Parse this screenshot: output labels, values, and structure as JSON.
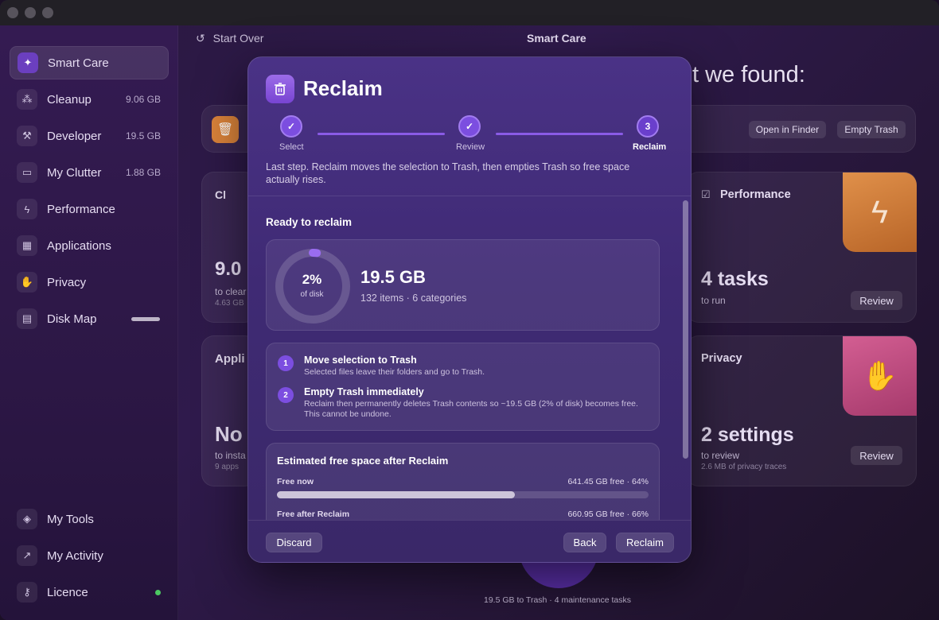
{
  "header": {
    "start_over": "Start Over",
    "title": "Smart Care",
    "found_title": "t we found:"
  },
  "sidebar": {
    "items": [
      {
        "label": "Smart Care",
        "size": ""
      },
      {
        "label": "Cleanup",
        "size": "9.06 GB"
      },
      {
        "label": "Developer",
        "size": "19.5 GB"
      },
      {
        "label": "My Clutter",
        "size": "1.88 GB"
      },
      {
        "label": "Performance",
        "size": ""
      },
      {
        "label": "Applications",
        "size": ""
      },
      {
        "label": "Privacy",
        "size": ""
      },
      {
        "label": "Disk Map",
        "size": ""
      }
    ],
    "bottom_items": [
      {
        "label": "My Tools"
      },
      {
        "label": "My Activity"
      },
      {
        "label": "Licence"
      }
    ]
  },
  "background": {
    "top_card": {
      "open_finder": "Open in Finder",
      "empty_trash": "Empty Trash"
    },
    "left_card_1": {
      "title": "Cl",
      "big": "9.0",
      "sub": "to clear",
      "sub2": "4.63 GB"
    },
    "left_card_2": {
      "title": "Appli",
      "big": "No",
      "sub": "to insta",
      "sub2": "9 apps"
    },
    "performance": {
      "title": "Performance",
      "big": "4 tasks",
      "sub": "to run",
      "button": "Review"
    },
    "privacy": {
      "title": "Privacy",
      "big": "2 settings",
      "sub": "to review",
      "sub2": "2.6 MB of privacy traces",
      "button": "Review"
    },
    "footer": "19.5 GB to Trash · 4 maintenance tasks"
  },
  "modal": {
    "title": "Reclaim",
    "steps": [
      {
        "label": "Select",
        "mark": "✓"
      },
      {
        "label": "Review",
        "mark": "✓"
      },
      {
        "label": "Reclaim",
        "mark": "3"
      }
    ],
    "description": "Last step. Reclaim moves the selection to Trash, then empties Trash so free space actually rises.",
    "ready_title": "Ready to reclaim",
    "ring": {
      "percent_label": "2%",
      "percent": 2,
      "sub": "of disk"
    },
    "total": "19.5 GB",
    "total_sub": "132 items · 6 categories",
    "actions": [
      {
        "num": "1",
        "title": "Move selection to Trash",
        "desc": "Selected files leave their folders and go to Trash."
      },
      {
        "num": "2",
        "title": "Empty Trash immediately",
        "desc": "Reclaim then permanently deletes Trash contents so ~19.5 GB (2% of disk) becomes free. This cannot be undone."
      }
    ],
    "estimate": {
      "title": "Estimated free space after Reclaim",
      "rows": [
        {
          "label": "Free now",
          "value": "641.45 GB free · 64%",
          "fraction": 0.64
        },
        {
          "label": "Free after Reclaim",
          "value": "660.95 GB free · 66%",
          "fraction": 0.66
        }
      ]
    },
    "buttons": {
      "discard": "Discard",
      "back": "Back",
      "reclaim": "Reclaim"
    }
  },
  "colors": {
    "accent": "#7c4ee0",
    "orange": "#d9823a",
    "pink": "#c0487a",
    "status_green": "#4cc862"
  }
}
